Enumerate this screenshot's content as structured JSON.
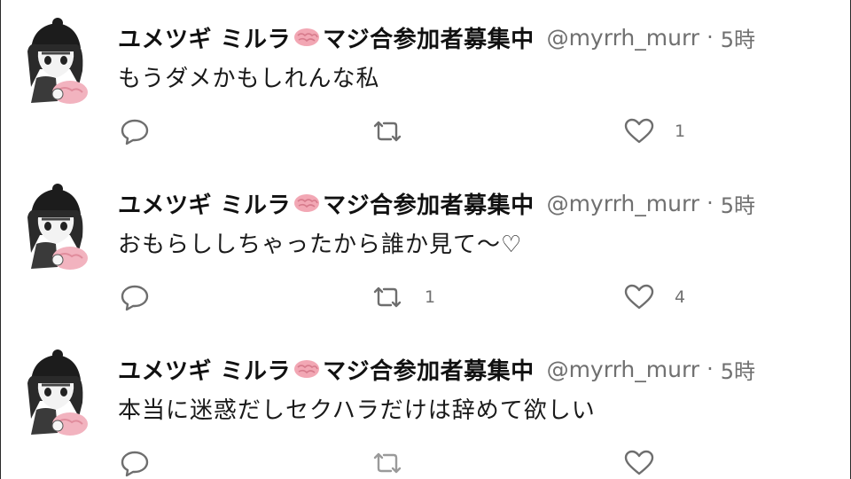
{
  "tweets": [
    {
      "display_name_part1": "ユメツギ ミルラ",
      "display_name_part2": "マジ合参加者募集中",
      "handle": "@myrrh_murr",
      "separator": "·",
      "time": "5時",
      "text": "もうダメかもしれんな私",
      "retweets": "",
      "likes": "1"
    },
    {
      "display_name_part1": "ユメツギ ミルラ",
      "display_name_part2": "マジ合参加者募集中",
      "handle": "@myrrh_murr",
      "separator": "·",
      "time": "5時",
      "text": "おもらししちゃったから誰か見て〜♡",
      "retweets": "1",
      "likes": "4"
    },
    {
      "display_name_part1": "ユメツギ ミルラ",
      "display_name_part2": "マジ合参加者募集中",
      "handle": "@myrrh_murr",
      "separator": "·",
      "time": "5時",
      "text": "本当に迷惑だしセクハラだけは辞めて欲しい",
      "retweets": "",
      "likes": ""
    }
  ],
  "icons": {
    "avatar": "anime-girl-avatar",
    "name_emoji": "brain-icon",
    "reply": "reply-icon",
    "retweet": "retweet-icon",
    "like": "heart-icon"
  },
  "colors": {
    "text": "#1a1a1a",
    "muted": "#707070",
    "brain": "#f2a7b4"
  }
}
